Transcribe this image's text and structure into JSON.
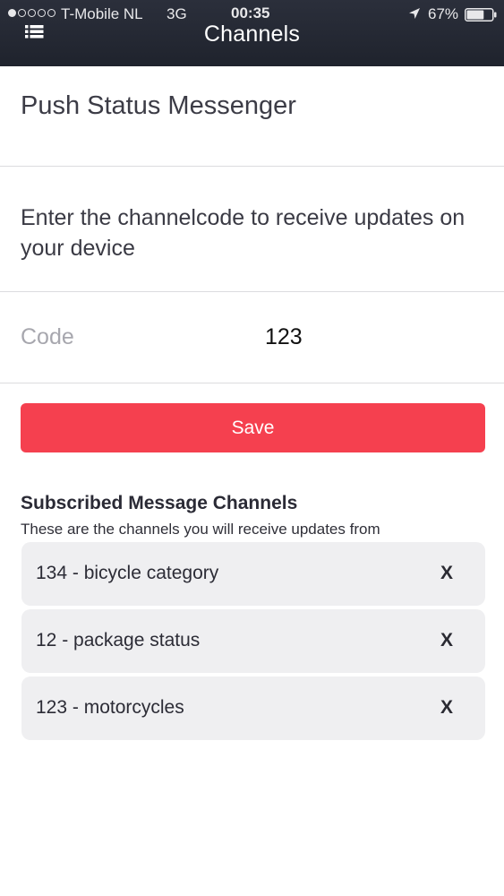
{
  "status_bar": {
    "carrier": "T-Mobile NL",
    "network": "3G",
    "time": "00:35",
    "battery_percent": "67%",
    "signal_bars_filled": 1,
    "battery_level": 0.67,
    "icons": [
      "signal-dots-icon",
      "location-arrow-icon",
      "battery-icon"
    ]
  },
  "nav": {
    "title": "Channels",
    "menu_icon": "list-menu-icon"
  },
  "app_title": "Push Status Messenger",
  "instruction": "Enter the channelcode to receive updates on your device",
  "code_field": {
    "label": "Code",
    "value": "123"
  },
  "save_label": "Save",
  "subscribed": {
    "title": "Subscribed Message Channels",
    "subtitle": "These are the channels you will receive updates from",
    "remove_label": "X",
    "channels": [
      {
        "label": "134 - bicycle category"
      },
      {
        "label": "12 - package status"
      },
      {
        "label": "123 - motorcycles"
      }
    ]
  },
  "colors": {
    "nav_background": "#23272f",
    "save_button": "#f5404f",
    "channel_background": "#efeff1"
  }
}
